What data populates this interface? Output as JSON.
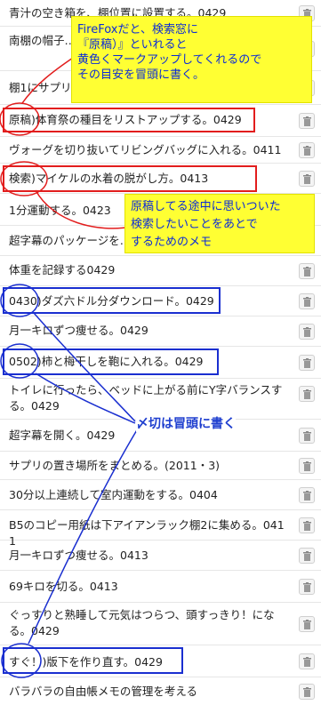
{
  "items": [
    {
      "text": "青汁の空き箱を、棚位置に設置する。0429"
    },
    {
      "text": "南棚の帽子…を洗う。…っぷらないようにする。0427"
    },
    {
      "text": "棚1にサプリ…"
    },
    {
      "text": "原稿)体育祭の種目をリストアップする。0429"
    },
    {
      "text": "ヴォーグを切り抜いてリビングバッグに入れる。0411"
    },
    {
      "text": "検索)マイケルの水着の脱がし方。0413"
    },
    {
      "text": "1分運動する。0423"
    },
    {
      "text": "超字幕のパッケージを…"
    },
    {
      "text": "体重を記録する0429"
    },
    {
      "text": "0430)ダズ六ドル分ダウンロード。0429"
    },
    {
      "text": "月一キロずつ痩せる。0429"
    },
    {
      "text": "0502)柿と梅干しを鞄に入れる。0429"
    },
    {
      "text": "トイレに行ったら、ベッドに上がる前にY字バランスする。0429"
    },
    {
      "text": "超字幕を開く。0429"
    },
    {
      "text": "サプリの置き場所をまとめる。(2011・3)"
    },
    {
      "text": "30分以上連続して室内運動をする。0404"
    },
    {
      "text": "B5のコピー用紙は下アイアンラック棚2に集める。0411"
    },
    {
      "text": "月一キロずつ痩せる。0413"
    },
    {
      "text": "69キロを切る。0413"
    },
    {
      "text": "ぐっすりと熟睡して元気はつらつ、頭すっきり！になる。0429"
    },
    {
      "text": "すぐ！)版下を作り直す。0429"
    },
    {
      "text": "バラバラの自由帳メモの管理を考える"
    }
  ],
  "notes": {
    "note1": [
      "FireFoxだと、検索窓に",
      "『原稿）』といれると",
      "黄色くマークアップしてくれるので",
      "その目安を冒頭に書く。"
    ],
    "note2": [
      "原稿してる途中に思いついた",
      "検索したいことをあとで",
      "するためのメモ"
    ],
    "note3": "〆切は冒頭に書く"
  },
  "colors": {
    "note_bg": "#ffff33",
    "note_text": "#0b2bd6",
    "red_mark": "#e21d1d",
    "blue_mark": "#1a2fd0"
  },
  "icons": {
    "row_action": "trash-icon"
  }
}
